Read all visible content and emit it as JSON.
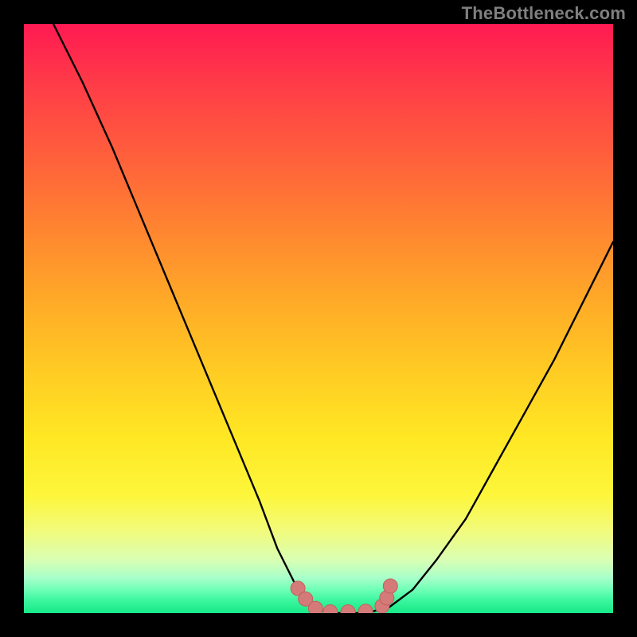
{
  "watermark": "TheBottleneck.com",
  "colors": {
    "frame": "#000000",
    "curve": "#000000",
    "marker_fill": "#d47a78",
    "marker_stroke": "#c0625f",
    "gradient_top": "#ff1a52",
    "gradient_bottom": "#17e987"
  },
  "chart_data": {
    "type": "line",
    "title": "",
    "xlabel": "",
    "ylabel": "",
    "xlim": [
      0,
      100
    ],
    "ylim": [
      0,
      100
    ],
    "grid": false,
    "legend": false,
    "series": [
      {
        "name": "bottleneck-curve",
        "x": [
          5,
          10,
          15,
          20,
          25,
          30,
          35,
          40,
          43,
          46,
          49,
          52,
          55,
          58,
          62,
          66,
          70,
          75,
          80,
          85,
          90,
          95,
          100
        ],
        "y": [
          100,
          90,
          79,
          67,
          55,
          43,
          31,
          19,
          11,
          5,
          1,
          0,
          0,
          0,
          1,
          4,
          9,
          16,
          25,
          34,
          43,
          53,
          63
        ]
      }
    ],
    "markers": {
      "name": "highlighted-points",
      "x": [
        46.5,
        47.8,
        49.5,
        52,
        55,
        58,
        60.8,
        61.6,
        62.2
      ],
      "y": [
        4.2,
        2.4,
        0.8,
        0.2,
        0.2,
        0.3,
        1.2,
        2.6,
        4.6
      ]
    }
  }
}
